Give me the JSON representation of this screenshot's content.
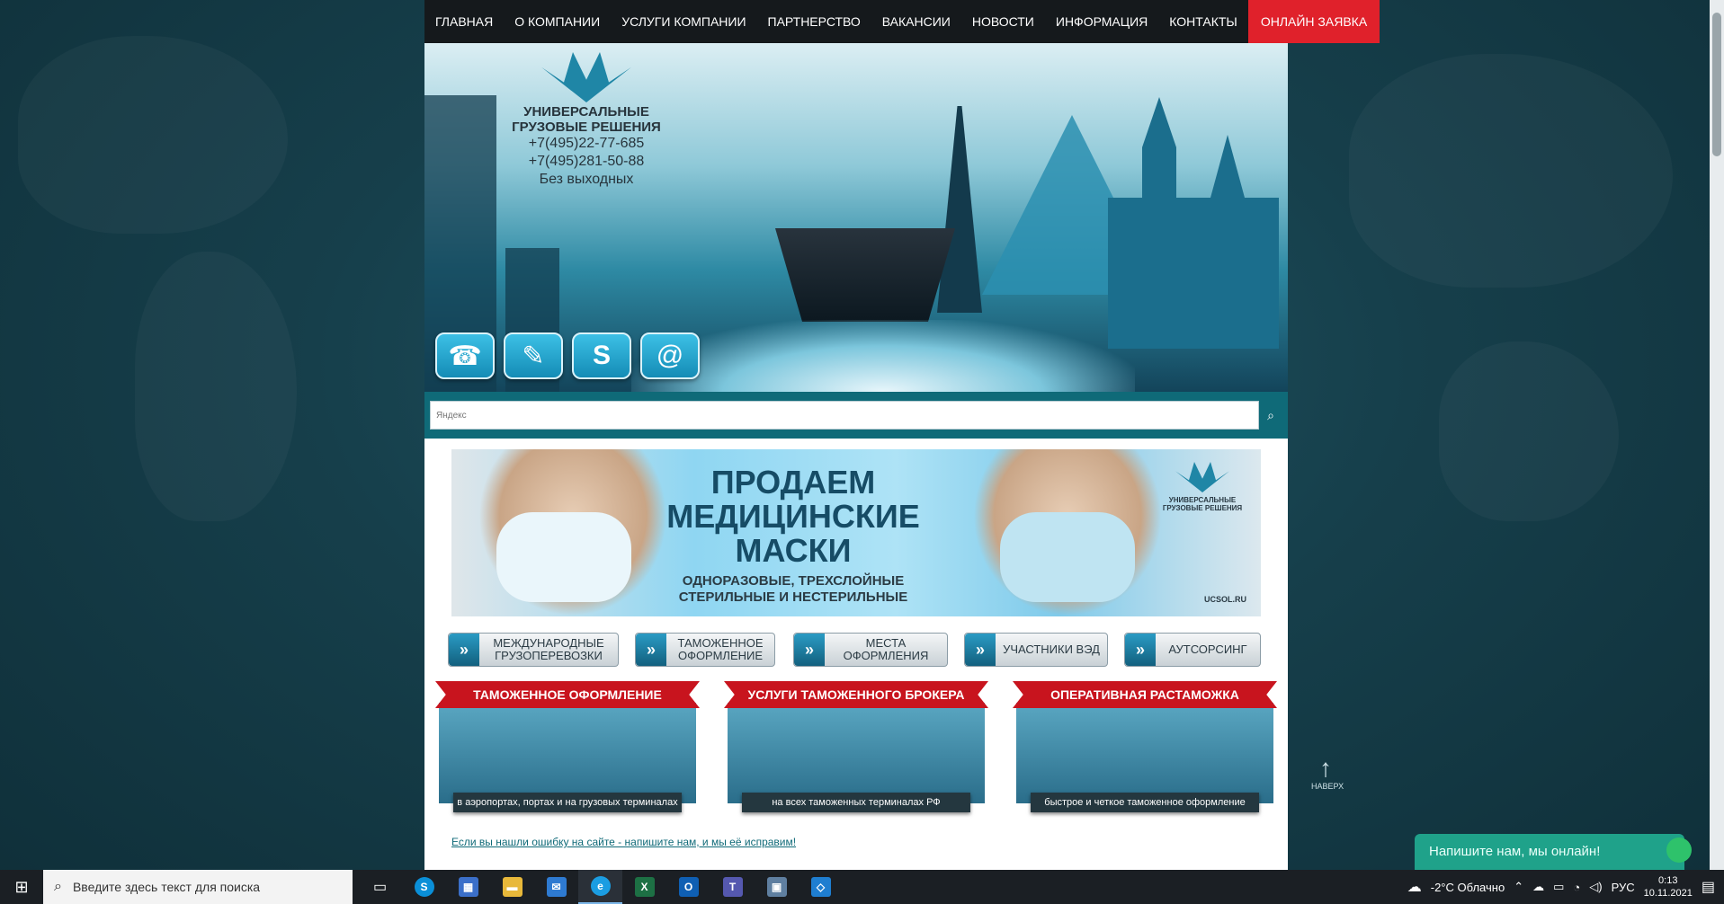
{
  "nav": {
    "items": [
      "ГЛАВНАЯ",
      "О КОМПАНИИ",
      "УСЛУГИ КОМПАНИИ",
      "ПАРТНЕРСТВО",
      "ВАКАНСИИ",
      "НОВОСТИ",
      "ИНФОРМАЦИЯ",
      "КОНТАКТЫ"
    ],
    "cta": "ОНЛАЙН ЗАЯВКА"
  },
  "logo": {
    "name_line1": "УНИВЕРСАЛЬНЫЕ",
    "name_line2": "ГРУЗОВЫЕ РЕШЕНИЯ",
    "phone1": "+7(495)22-77-685",
    "phone2": "+7(495)281-50-88",
    "hours": "Без выходных"
  },
  "contact_icons": [
    "phone-icon",
    "form-icon",
    "skype-icon",
    "email-icon"
  ],
  "search": {
    "placeholder": "Яндекс",
    "button_icon": "search-icon"
  },
  "banner": {
    "title_line1": "ПРОДАЕМ",
    "title_line2": "МЕДИЦИНСКИЕ",
    "title_line3": "МАСКИ",
    "sub_line1": "ОДНОРАЗОВЫЕ, ТРЕХСЛОЙНЫЕ",
    "sub_line2": "СТЕРИЛЬНЫЕ И НЕСТЕРИЛЬНЫЕ",
    "logo_line1": "УНИВЕРСАЛЬНЫЕ",
    "logo_line2": "ГРУЗОВЫЕ РЕШЕНИЯ",
    "site": "UCSOL.RU"
  },
  "subnav": [
    {
      "line1": "МЕЖДУНАРОДНЫЕ",
      "line2": "ГРУЗОПЕРЕВОЗКИ"
    },
    {
      "line1": "ТАМОЖЕННОЕ",
      "line2": "ОФОРМЛЕНИЕ"
    },
    {
      "line1": "МЕСТА",
      "line2": "ОФОРМЛЕНИЯ"
    },
    {
      "line1": "УЧАСТНИКИ ВЭД",
      "line2": ""
    },
    {
      "line1": "АУТСОРСИНГ",
      "line2": ""
    }
  ],
  "cards": [
    {
      "title": "ТАМОЖЕННОЕ ОФОРМЛЕНИЕ",
      "caption": "в аэропортах, портах и на грузовых терминалах"
    },
    {
      "title": "УСЛУГИ ТАМОЖЕННОГО БРОКЕРА",
      "caption": "на всех таможенных терминалах РФ"
    },
    {
      "title": "ОПЕРАТИВНАЯ РАСТАМОЖКА",
      "caption": "быстрое и четкое таможенное оформление"
    }
  ],
  "error_link": "Если вы нашли ошибку на сайте - напишите нам, и мы её исправим!",
  "to_top": "НАВЕРХ",
  "chat": "Напишите нам, мы онлайн!",
  "taskbar": {
    "search_placeholder": "Введите здесь текст для поиска",
    "weather": "-2°C  Облачно",
    "lang": "РУС",
    "time": "0:13",
    "date": "10.11.2021"
  },
  "colors": {
    "accent_red": "#e0212b",
    "teal": "#0f6a78",
    "chat_green": "#1fa28a"
  }
}
